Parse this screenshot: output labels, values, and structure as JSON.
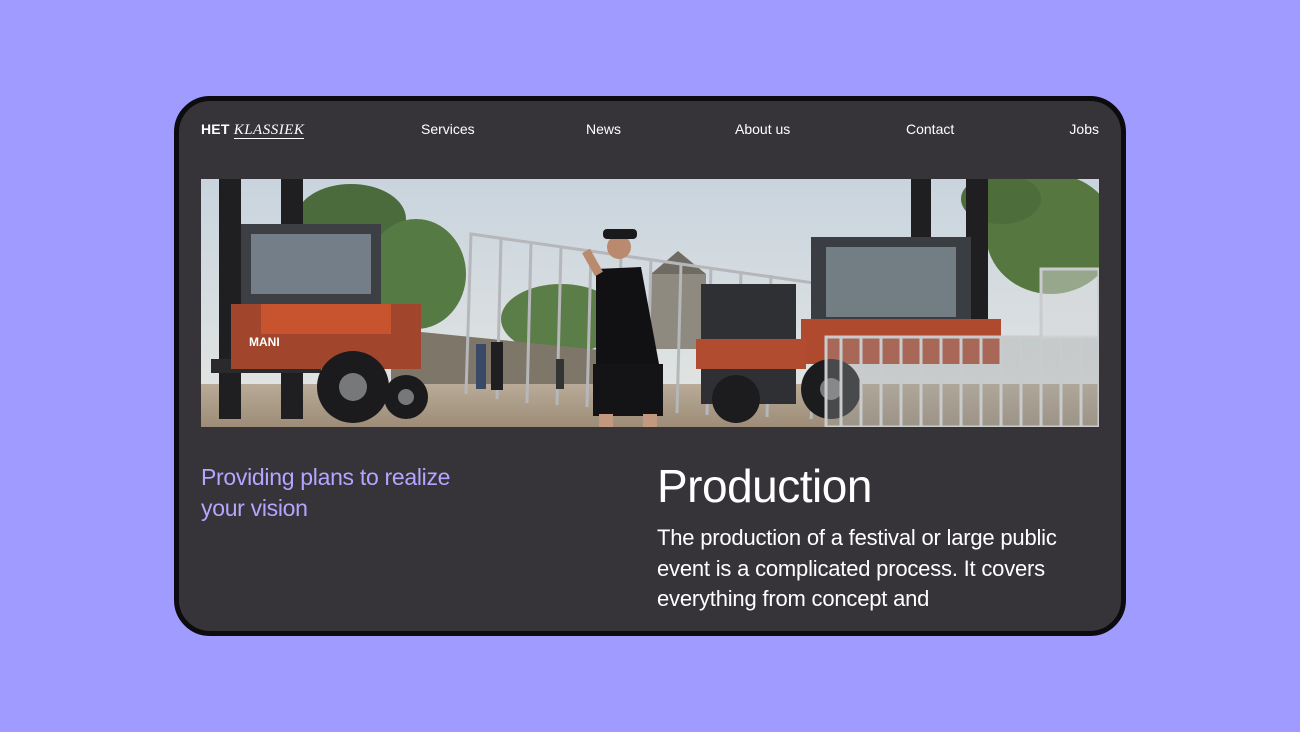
{
  "logo": {
    "primary": "HET",
    "secondary": "KLASSIEK"
  },
  "nav": {
    "services": "Services",
    "news": "News",
    "about": "About us",
    "contact": "Contact",
    "jobs": "Jobs"
  },
  "hero": {
    "forklift_brand": "MANI"
  },
  "tagline": "Providing plans to realize your vision",
  "production": {
    "title": "Production",
    "body": "The production of a festival or large public event is a complicated process. It covers everything from concept and"
  },
  "colors": {
    "page_background": "#a09bff",
    "card_background": "#363339",
    "device_frame": "#0c0b0e",
    "accent_text": "#b3a6ff",
    "primary_text": "#ffffff"
  }
}
